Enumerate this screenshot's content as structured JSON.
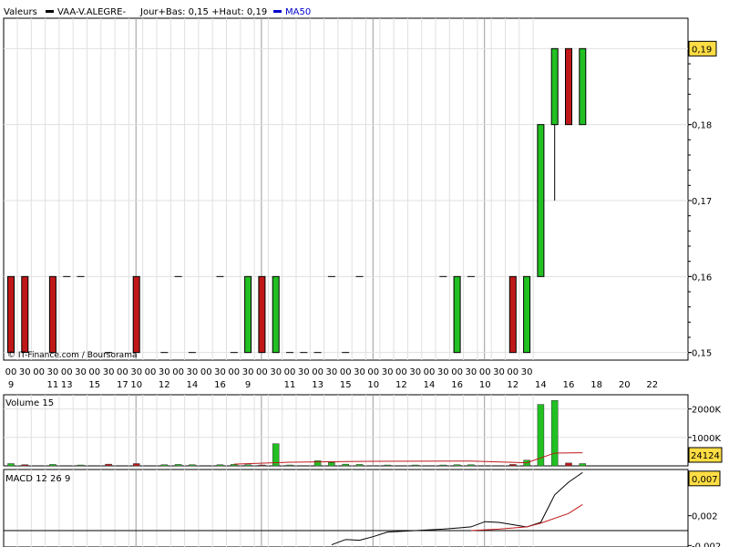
{
  "header": {
    "label": "Valeurs",
    "symbol": "VAA-V.ALEGRE-",
    "stats": "Jour+Bas: 0,15 +Haut: 0,19",
    "ma_label": "MA50",
    "source": "© IT-Finance.com / Boursorama"
  },
  "colors": {
    "up": "#22c022",
    "down": "#c01818",
    "grid": "#e0e0e0",
    "divider": "#999999",
    "ma": "#0000cc",
    "label_box": "#ffdd44"
  },
  "chart_data": [
    {
      "type": "candlestick",
      "title": "VAA-V.ALEGRE-",
      "ylim": [
        0.149,
        0.194
      ],
      "y_ticks": [
        "0,15",
        "0,16",
        "0,17",
        "0,18",
        "0,19"
      ],
      "last_value_label": "0,19",
      "x_hour_labels": [
        "00",
        "30",
        "00",
        "30",
        "00",
        "30",
        "00",
        "30",
        "00",
        "30",
        "00",
        "30",
        "00",
        "30",
        "00",
        "30",
        "00",
        "30",
        "00",
        "30",
        "00",
        "30",
        "00",
        "30",
        "00",
        "30",
        "00",
        "30",
        "00",
        "30",
        "00",
        "30",
        "00",
        "30",
        "00",
        "30",
        "00",
        "30"
      ],
      "x_day_labels": [
        {
          "slot": 0,
          "text": "9"
        },
        {
          "slot": 3,
          "text": "11"
        },
        {
          "slot": 4,
          "text": "13"
        },
        {
          "slot": 6,
          "text": "15"
        },
        {
          "slot": 8,
          "text": "17"
        },
        {
          "slot": 9,
          "text": "10"
        },
        {
          "slot": 11,
          "text": "12"
        },
        {
          "slot": 13,
          "text": "14"
        },
        {
          "slot": 15,
          "text": "16"
        },
        {
          "slot": 17,
          "text": "9"
        },
        {
          "slot": 20,
          "text": "11"
        },
        {
          "slot": 22,
          "text": "13"
        },
        {
          "slot": 24,
          "text": "15"
        },
        {
          "slot": 26,
          "text": "10"
        },
        {
          "slot": 28,
          "text": "12"
        },
        {
          "slot": 30,
          "text": "14"
        },
        {
          "slot": 32,
          "text": "16"
        },
        {
          "slot": 34,
          "text": "10"
        },
        {
          "slot": 36,
          "text": "12"
        },
        {
          "slot": 38,
          "text": "14"
        },
        {
          "slot": 40,
          "text": "16"
        },
        {
          "slot": 42,
          "text": "18"
        },
        {
          "slot": 44,
          "text": "20"
        },
        {
          "slot": 46,
          "text": "22"
        }
      ],
      "candles": [
        {
          "i": 0,
          "o": 0.16,
          "c": 0.15,
          "h": 0.16,
          "l": 0.15
        },
        {
          "i": 1,
          "o": 0.16,
          "c": 0.15,
          "h": 0.16,
          "l": 0.15
        },
        {
          "i": 3,
          "o": 0.16,
          "c": 0.15,
          "h": 0.16,
          "l": 0.15
        },
        {
          "i": 4,
          "o": 0.16,
          "c": 0.16,
          "h": 0.16,
          "l": 0.16
        },
        {
          "i": 5,
          "o": 0.16,
          "c": 0.16,
          "h": 0.16,
          "l": 0.16
        },
        {
          "i": 7,
          "o": 0.15,
          "c": 0.15,
          "h": 0.15,
          "l": 0.15
        },
        {
          "i": 9,
          "o": 0.16,
          "c": 0.15,
          "h": 0.16,
          "l": 0.15
        },
        {
          "i": 11,
          "o": 0.15,
          "c": 0.15,
          "h": 0.15,
          "l": 0.15
        },
        {
          "i": 12,
          "o": 0.16,
          "c": 0.16,
          "h": 0.16,
          "l": 0.16
        },
        {
          "i": 13,
          "o": 0.15,
          "c": 0.15,
          "h": 0.15,
          "l": 0.15
        },
        {
          "i": 15,
          "o": 0.16,
          "c": 0.16,
          "h": 0.16,
          "l": 0.16
        },
        {
          "i": 16,
          "o": 0.15,
          "c": 0.15,
          "h": 0.15,
          "l": 0.15
        },
        {
          "i": 17,
          "o": 0.15,
          "c": 0.16,
          "h": 0.16,
          "l": 0.15
        },
        {
          "i": 18,
          "o": 0.16,
          "c": 0.15,
          "h": 0.16,
          "l": 0.15
        },
        {
          "i": 19,
          "o": 0.15,
          "c": 0.16,
          "h": 0.16,
          "l": 0.15
        },
        {
          "i": 20,
          "o": 0.15,
          "c": 0.15,
          "h": 0.15,
          "l": 0.15
        },
        {
          "i": 21,
          "o": 0.15,
          "c": 0.15,
          "h": 0.15,
          "l": 0.15
        },
        {
          "i": 22,
          "o": 0.15,
          "c": 0.15,
          "h": 0.15,
          "l": 0.15
        },
        {
          "i": 23,
          "o": 0.16,
          "c": 0.16,
          "h": 0.16,
          "l": 0.16
        },
        {
          "i": 24,
          "o": 0.15,
          "c": 0.15,
          "h": 0.15,
          "l": 0.15
        },
        {
          "i": 25,
          "o": 0.16,
          "c": 0.16,
          "h": 0.16,
          "l": 0.16
        },
        {
          "i": 31,
          "o": 0.16,
          "c": 0.16,
          "h": 0.16,
          "l": 0.16
        },
        {
          "i": 32,
          "o": 0.15,
          "c": 0.16,
          "h": 0.16,
          "l": 0.15
        },
        {
          "i": 33,
          "o": 0.16,
          "c": 0.16,
          "h": 0.16,
          "l": 0.16
        },
        {
          "i": 36,
          "o": 0.16,
          "c": 0.15,
          "h": 0.16,
          "l": 0.15
        },
        {
          "i": 37,
          "o": 0.15,
          "c": 0.16,
          "h": 0.16,
          "l": 0.15
        },
        {
          "i": 38,
          "o": 0.16,
          "c": 0.18,
          "h": 0.18,
          "l": 0.16
        },
        {
          "i": 39,
          "o": 0.18,
          "c": 0.19,
          "h": 0.19,
          "l": 0.17
        },
        {
          "i": 40,
          "o": 0.19,
          "c": 0.18,
          "h": 0.19,
          "l": 0.18
        },
        {
          "i": 41,
          "o": 0.18,
          "c": 0.19,
          "h": 0.19,
          "l": 0.18
        }
      ]
    },
    {
      "type": "bar",
      "title": "Volume 15",
      "ylim": [
        0,
        2500
      ],
      "y_ticks": [
        "1000K",
        "2000K"
      ],
      "last_value_label": "24124",
      "volumes": [
        {
          "i": 0,
          "v": 80,
          "d": "up"
        },
        {
          "i": 1,
          "v": 40,
          "d": "down"
        },
        {
          "i": 3,
          "v": 50,
          "d": "up"
        },
        {
          "i": 5,
          "v": 30,
          "d": "up"
        },
        {
          "i": 7,
          "v": 60,
          "d": "down"
        },
        {
          "i": 9,
          "v": 80,
          "d": "down"
        },
        {
          "i": 11,
          "v": 40,
          "d": "up"
        },
        {
          "i": 12,
          "v": 50,
          "d": "up"
        },
        {
          "i": 13,
          "v": 40,
          "d": "up"
        },
        {
          "i": 15,
          "v": 40,
          "d": "up"
        },
        {
          "i": 16,
          "v": 50,
          "d": "up"
        },
        {
          "i": 17,
          "v": 40,
          "d": "up"
        },
        {
          "i": 18,
          "v": 30,
          "d": "down"
        },
        {
          "i": 19,
          "v": 780,
          "d": "up"
        },
        {
          "i": 20,
          "v": 30,
          "d": "up"
        },
        {
          "i": 22,
          "v": 180,
          "d": "up"
        },
        {
          "i": 23,
          "v": 120,
          "d": "up"
        },
        {
          "i": 24,
          "v": 60,
          "d": "up"
        },
        {
          "i": 25,
          "v": 50,
          "d": "up"
        },
        {
          "i": 27,
          "v": 30,
          "d": "up"
        },
        {
          "i": 29,
          "v": 30,
          "d": "up"
        },
        {
          "i": 31,
          "v": 30,
          "d": "up"
        },
        {
          "i": 32,
          "v": 40,
          "d": "up"
        },
        {
          "i": 33,
          "v": 40,
          "d": "up"
        },
        {
          "i": 36,
          "v": 50,
          "d": "down"
        },
        {
          "i": 37,
          "v": 200,
          "d": "up"
        },
        {
          "i": 38,
          "v": 2160,
          "d": "up"
        },
        {
          "i": 39,
          "v": 2300,
          "d": "up"
        },
        {
          "i": 40,
          "v": 100,
          "d": "down"
        },
        {
          "i": 41,
          "v": 80,
          "d": "up"
        }
      ],
      "ma": [
        [
          16,
          60
        ],
        [
          20,
          130
        ],
        [
          26,
          160
        ],
        [
          33,
          170
        ],
        [
          37,
          110
        ],
        [
          39,
          450
        ],
        [
          41,
          460
        ]
      ]
    },
    {
      "type": "line",
      "title": "MACD 12 26 9",
      "ylim": [
        -0.0022,
        0.0082
      ],
      "y_ticks": [
        "0,002",
        "-0,002"
      ],
      "last_value_label": "0,007",
      "macd": [
        [
          23,
          -0.0019
        ],
        [
          24,
          -0.0012
        ],
        [
          25,
          -0.0013
        ],
        [
          26,
          -0.0008
        ],
        [
          27,
          -0.0002
        ],
        [
          29,
          0.0
        ],
        [
          31,
          0.0002
        ],
        [
          33,
          0.0005
        ],
        [
          34,
          0.0012
        ],
        [
          35,
          0.0011
        ],
        [
          37,
          0.0005
        ],
        [
          38,
          0.0011
        ],
        [
          39,
          0.0048
        ],
        [
          40,
          0.0065
        ],
        [
          41,
          0.0078
        ]
      ],
      "signal": [
        [
          33,
          0.0
        ],
        [
          35,
          0.0002
        ],
        [
          37,
          0.0005
        ],
        [
          38,
          0.001
        ],
        [
          40,
          0.0023
        ],
        [
          41,
          0.0035
        ]
      ]
    }
  ]
}
